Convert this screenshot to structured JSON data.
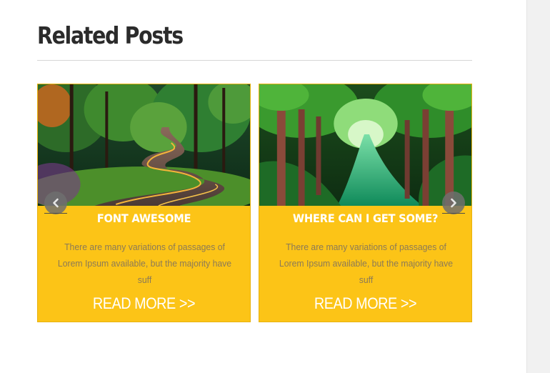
{
  "section": {
    "title": "Related Posts"
  },
  "posts": [
    {
      "title": "FONT AWESOME",
      "excerpt": "There are many variations of passages of Lorem Ipsum available, but the majority have suff",
      "read_more": "READ MORE >>",
      "image": "winding-forest-road-photo"
    },
    {
      "title": "WHERE CAN I GET SOME?",
      "excerpt": "There are many variations of passages of Lorem Ipsum available, but the majority have suff",
      "read_more": "READ MORE >>",
      "image": "green-forest-river-photo"
    }
  ],
  "carousel": {
    "prev_icon": "chevron-left-icon",
    "next_icon": "chevron-right-icon"
  },
  "colors": {
    "card_background": "#fcc417",
    "title_text": "#2b2b2b",
    "excerpt_text": "#8b7a57"
  }
}
